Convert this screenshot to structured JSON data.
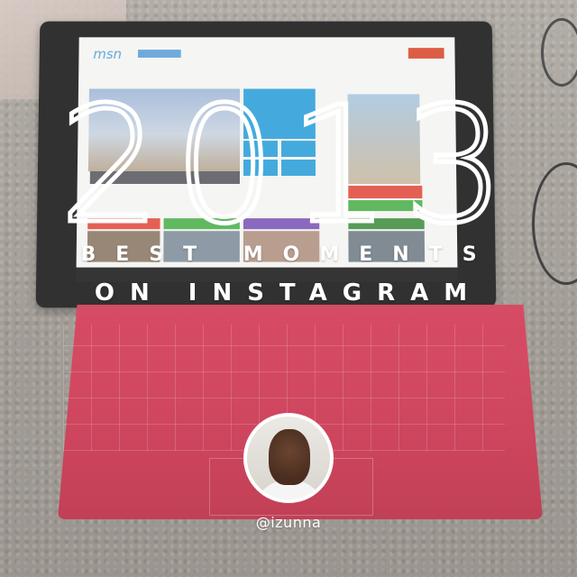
{
  "overlay": {
    "year": "2013",
    "line1": "BEST MOMENTS",
    "line2": "ON INSTAGRAM",
    "handle": "@izunna"
  },
  "colors": {
    "keyboard": "#c82c48",
    "accent_blue": "#2b9fd9",
    "text": "#ffffff"
  }
}
